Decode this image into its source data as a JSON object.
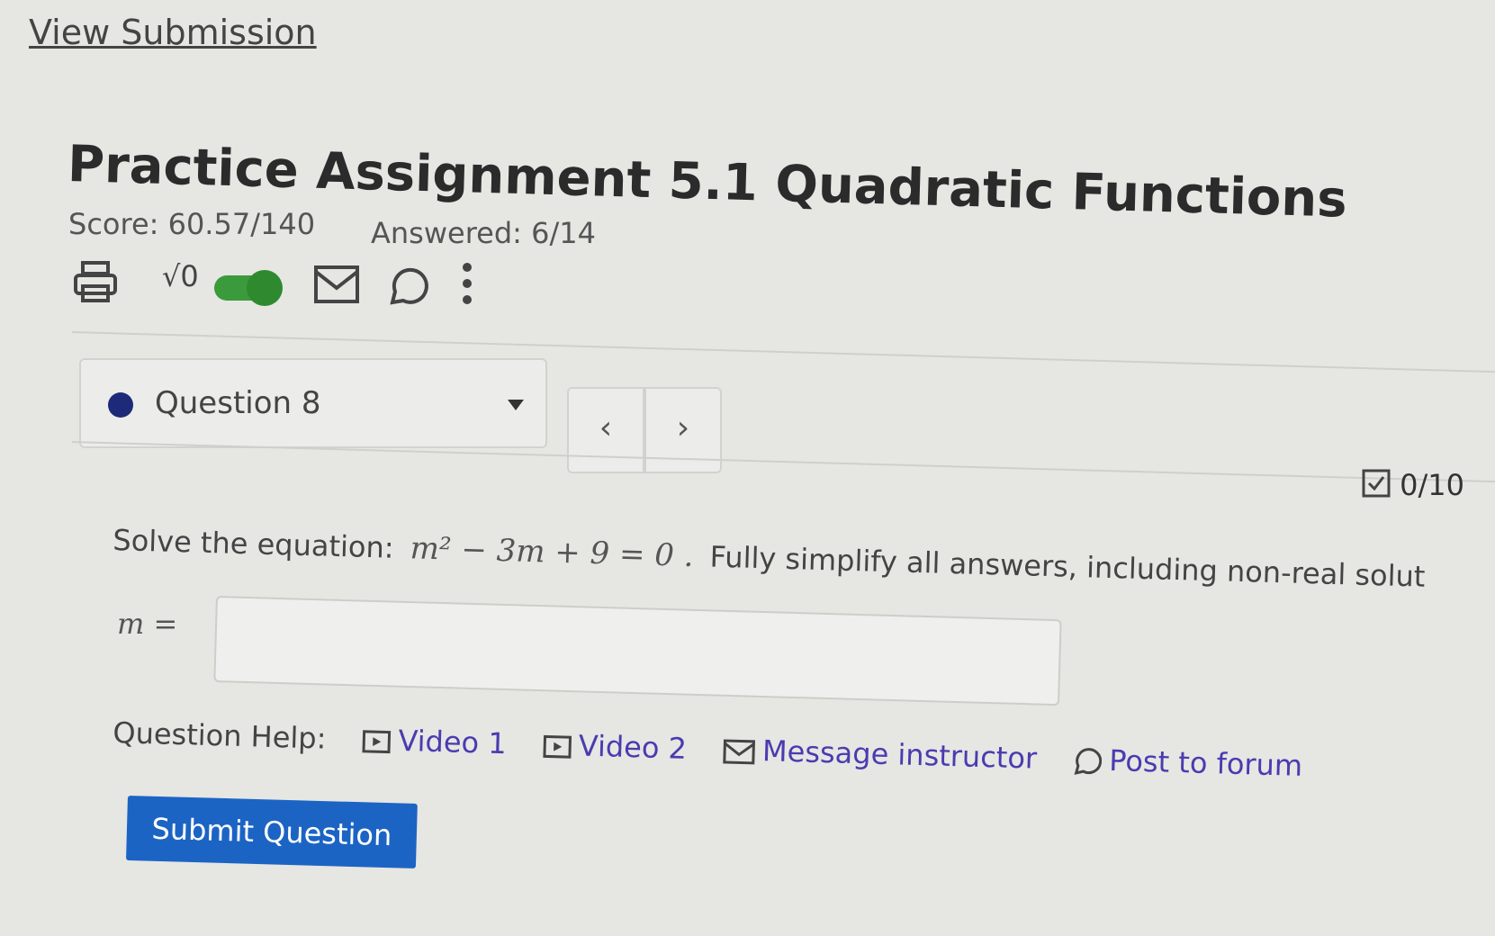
{
  "header": {
    "view_submission": "View Submission",
    "title": "Practice Assignment 5.1 Quadratic Functions",
    "score": "Score: 60.57/140",
    "answered": "Answered: 6/14"
  },
  "toolbar": {
    "icons": [
      "print-icon",
      "sqrt-icon",
      "math-toggle",
      "mail-icon",
      "forum-icon",
      "more-vertical-icon"
    ],
    "sqrt_glyph": "√0",
    "toggle_on": true,
    "colors": {
      "toggle": "#3b9a3b"
    }
  },
  "question_nav": {
    "selected": "Question 8",
    "prev": "‹",
    "next": "›"
  },
  "question": {
    "points": "0/10",
    "prompt_prefix": "Solve the equation:",
    "equation": "m² − 3m + 9 = 0 .",
    "prompt_suffix": "Fully simplify all answers, including non-real solut",
    "answer_label": "m =",
    "answer_value": ""
  },
  "help": {
    "label": "Question Help:",
    "links": [
      {
        "icon": "video-icon",
        "label": "Video 1"
      },
      {
        "icon": "video-icon",
        "label": "Video 2"
      },
      {
        "icon": "mail-icon",
        "label": "Message instructor"
      },
      {
        "icon": "forum-icon",
        "label": "Post to forum"
      }
    ]
  },
  "submit": {
    "label": "Submit Question",
    "color": "#1c64c4"
  }
}
